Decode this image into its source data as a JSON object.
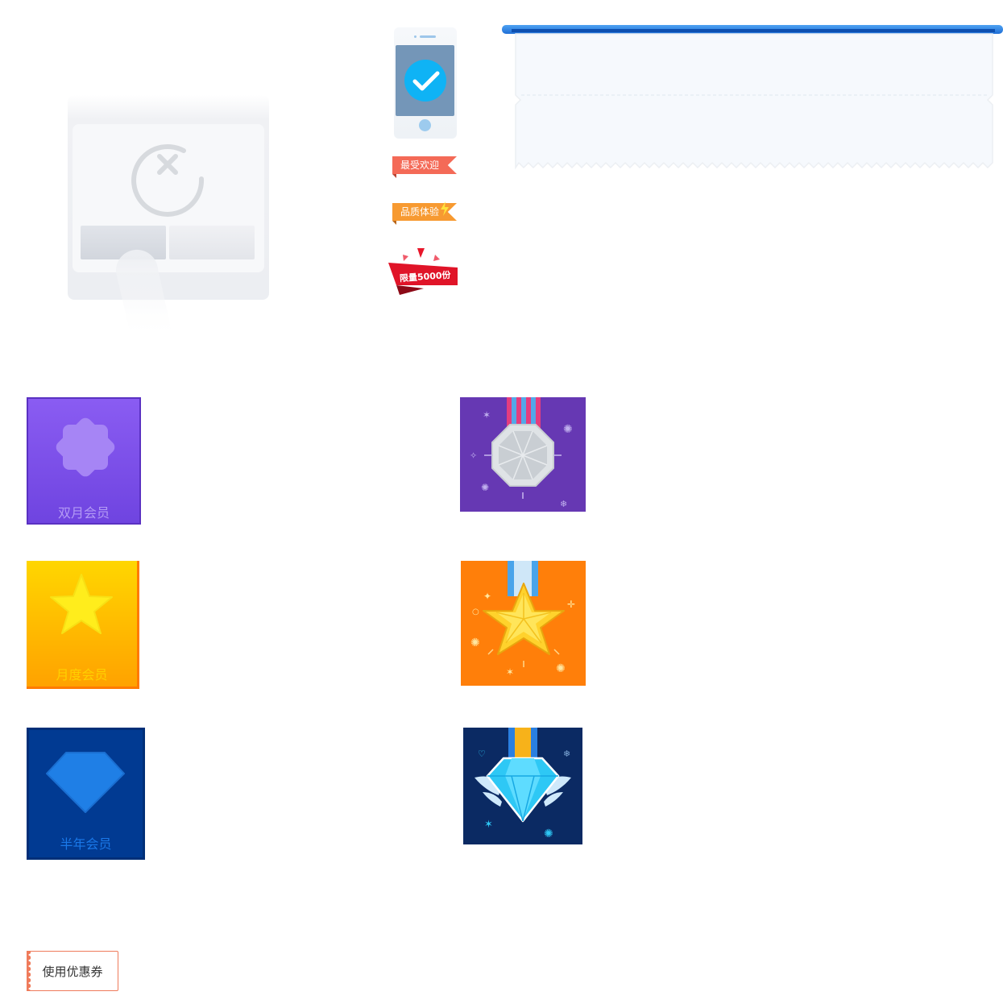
{
  "tags": {
    "popular": "最受欢迎",
    "quality": "品质体验",
    "limited": "限量5000份"
  },
  "membership_cards": {
    "bimonthly": "双月会员",
    "monthly": "月度会员",
    "halfyear": "半年会员"
  },
  "coupon": {
    "label": "使用优惠券"
  },
  "colors": {
    "brand_blue": "#2f80e0",
    "coupon_border": "#ef7b5b",
    "purple": "#7a4ee8",
    "orange": "#ff8f00",
    "navy": "#013a92"
  }
}
